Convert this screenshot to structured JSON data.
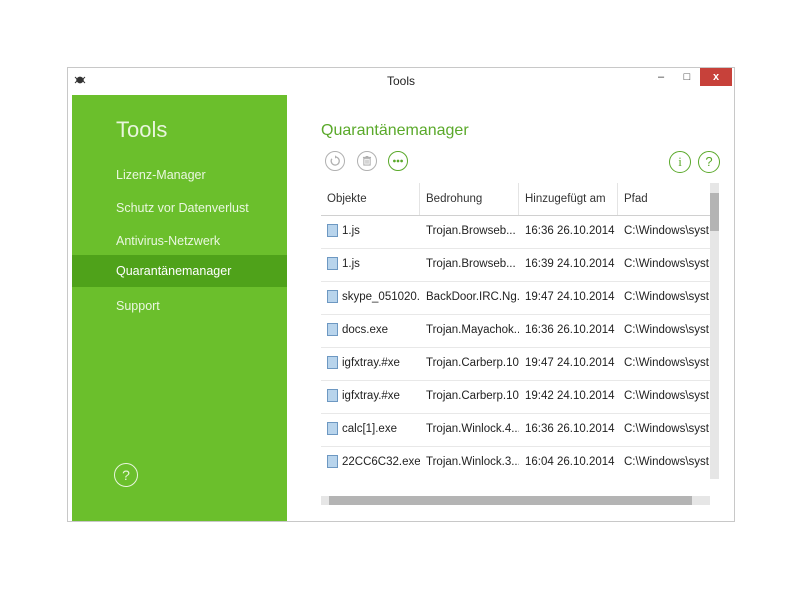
{
  "window": {
    "title": "Tools",
    "controls": {
      "minimize": "–",
      "maximize": "□",
      "close": "x"
    }
  },
  "sidebar": {
    "title": "Tools",
    "items": [
      {
        "label": "Lizenz-Manager",
        "active": false
      },
      {
        "label": "Schutz vor Datenverlust",
        "active": false
      },
      {
        "label": "Antivirus-Netzwerk",
        "active": false
      },
      {
        "label": "Quarantänemanager",
        "active": true
      },
      {
        "label": "Support",
        "active": false
      }
    ],
    "help_icon": "?"
  },
  "main": {
    "title": "Quarantänemanager",
    "toolbar": {
      "restore_icon": "restore-icon",
      "delete_icon": "trash-icon",
      "more_icon": "more-icon",
      "info_label": "i",
      "help_label": "?"
    },
    "table": {
      "columns": [
        "Objekte",
        "Bedrohung",
        "Hinzugefügt am",
        "Pfad"
      ],
      "rows": [
        [
          "1.js",
          "Trojan.Browseb...",
          "16:36 26.10.2014",
          "C:\\Windows\\syst..."
        ],
        [
          "1.js",
          "Trojan.Browseb...",
          "16:39 24.10.2014",
          "C:\\Windows\\syst..."
        ],
        [
          "skype_051020...",
          "BackDoor.IRC.Ng...",
          "19:47 24.10.2014",
          "C:\\Windows\\syst..."
        ],
        [
          "docs.exe",
          "Trojan.Mayachok...",
          "16:36 26.10.2014",
          "C:\\Windows\\syst..."
        ],
        [
          "igfxtray.#xe",
          "Trojan.Carberp.10",
          "19:47 24.10.2014",
          "C:\\Windows\\syst..."
        ],
        [
          "igfxtray.#xe",
          "Trojan.Carberp.10",
          "19:42 24.10.2014",
          "C:\\Windows\\syst..."
        ],
        [
          "calc[1].exe",
          "Trojan.Winlock.4...",
          "16:36 26.10.2014",
          "C:\\Windows\\syst..."
        ],
        [
          "22CC6C32.exe",
          "Trojan.Winlock.3...",
          "16:04 26.10.2014",
          "C:\\Windows\\syst..."
        ]
      ]
    }
  },
  "colors": {
    "sidebar": "#6bbf2c",
    "sidebar_active": "#4fa21a",
    "accent": "#5aa92a",
    "close_button": "#c7413a"
  }
}
